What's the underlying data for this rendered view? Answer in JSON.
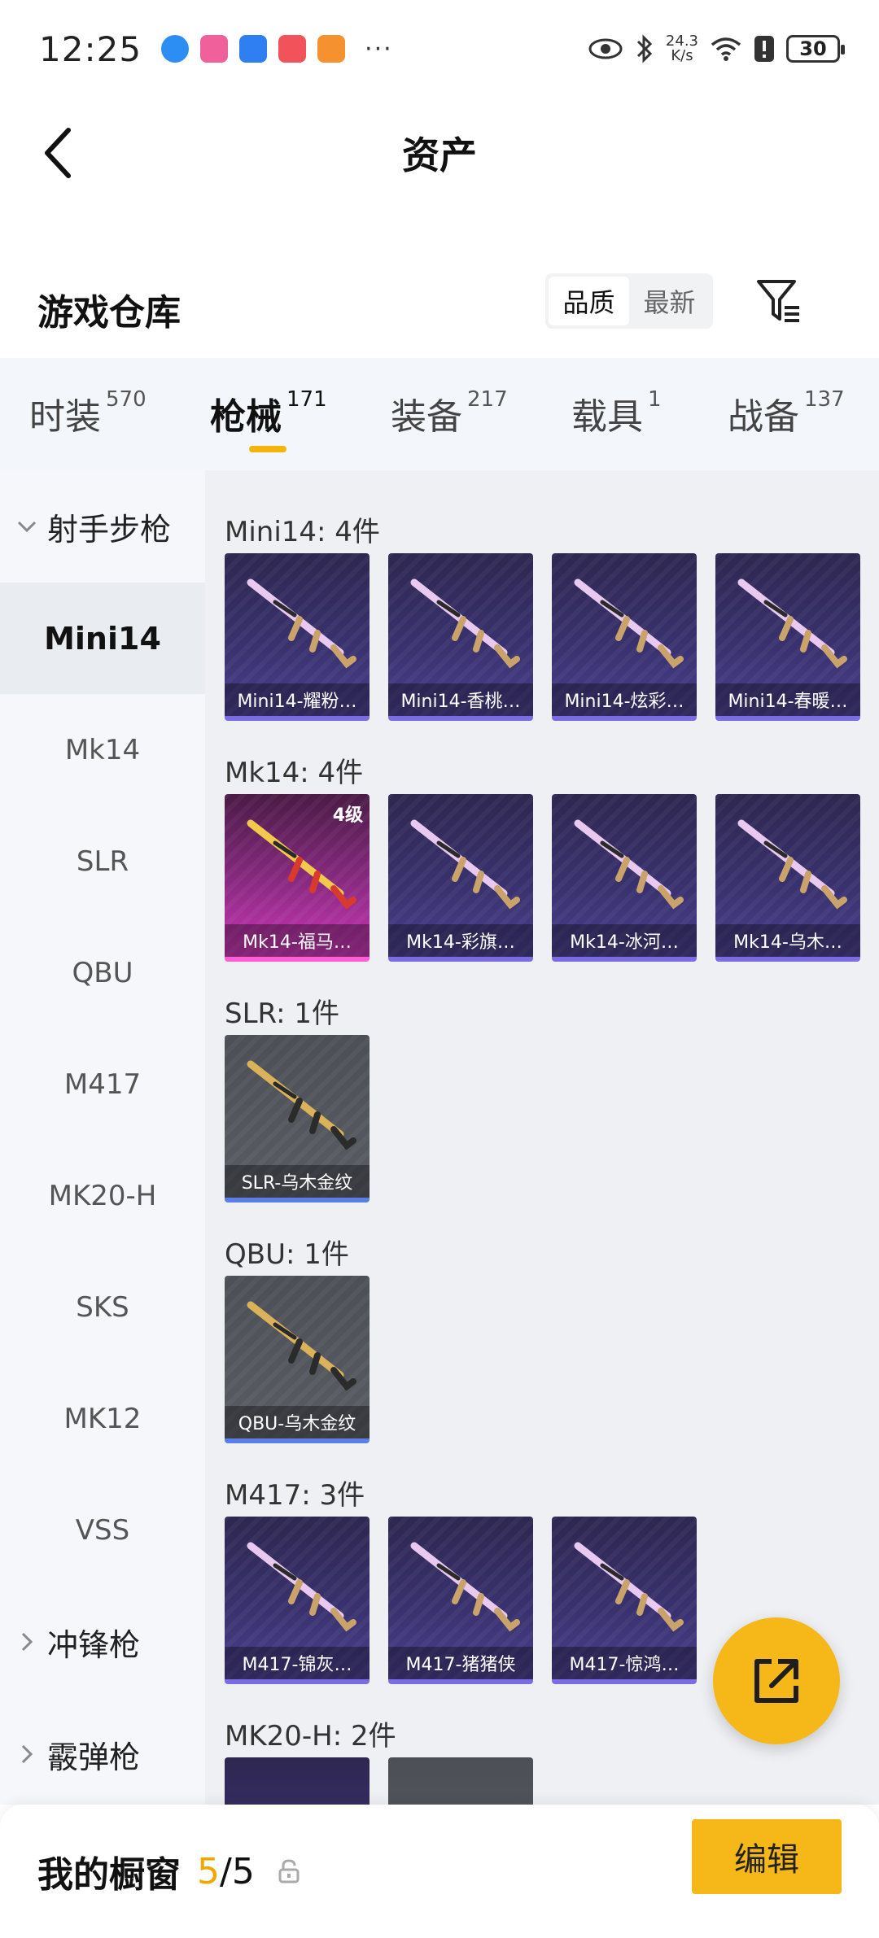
{
  "status_bar": {
    "time": "12:25",
    "net_speed_value": "24.3",
    "net_speed_unit": "K/s",
    "battery": "30",
    "more": "···"
  },
  "header": {
    "title": "资产"
  },
  "section": {
    "title": "游戏仓库",
    "sort_options": [
      "品质",
      "最新"
    ],
    "sort_active": "品质"
  },
  "tabs": [
    {
      "label": "时装",
      "count": "570"
    },
    {
      "label": "枪械",
      "count": "171"
    },
    {
      "label": "装备",
      "count": "217"
    },
    {
      "label": "载具",
      "count": "1"
    },
    {
      "label": "战备",
      "count": "137"
    }
  ],
  "sidebar": {
    "group_expanded": "射手步枪",
    "items": [
      "Mini14",
      "Mk14",
      "SLR",
      "QBU",
      "M417",
      "MK20-H",
      "SKS",
      "MK12",
      "VSS"
    ],
    "groups_collapsed": [
      "冲锋枪",
      "霰弹枪"
    ]
  },
  "groups": [
    {
      "label": "Mini14: 4件",
      "items": [
        {
          "name": "Mini14-耀粉…",
          "style": "purple"
        },
        {
          "name": "Mini14-香桃…",
          "style": "purple"
        },
        {
          "name": "Mini14-炫彩…",
          "style": "purple"
        },
        {
          "name": "Mini14-春暖…",
          "style": "purple"
        }
      ]
    },
    {
      "label": "Mk14: 4件",
      "items": [
        {
          "name": "Mk14-福马…",
          "style": "gold",
          "level": "4级"
        },
        {
          "name": "Mk14-彩旗…",
          "style": "purple"
        },
        {
          "name": "Mk14-冰河…",
          "style": "purple"
        },
        {
          "name": "Mk14-乌木…",
          "style": "purple"
        }
      ]
    },
    {
      "label": "SLR: 1件",
      "items": [
        {
          "name": "SLR-乌木金纹",
          "style": "gray"
        }
      ]
    },
    {
      "label": "QBU: 1件",
      "items": [
        {
          "name": "QBU-乌木金纹",
          "style": "gray"
        }
      ]
    },
    {
      "label": "M417: 3件",
      "items": [
        {
          "name": "M417-锦灰…",
          "style": "purple"
        },
        {
          "name": "M417-猪猪侠",
          "style": "purple"
        },
        {
          "name": "M417-惊鸿…",
          "style": "purple"
        }
      ]
    },
    {
      "label": "MK20-H: 2件",
      "items": []
    }
  ],
  "bottom": {
    "label": "我的橱窗",
    "count_current": "5",
    "count_sep": "/",
    "count_total": "5",
    "edit": "编辑"
  },
  "colors": {
    "accent": "#f6b818",
    "card_purple": "#3a3270",
    "card_gold": "#cc36b6",
    "card_gray": "#55575f"
  }
}
